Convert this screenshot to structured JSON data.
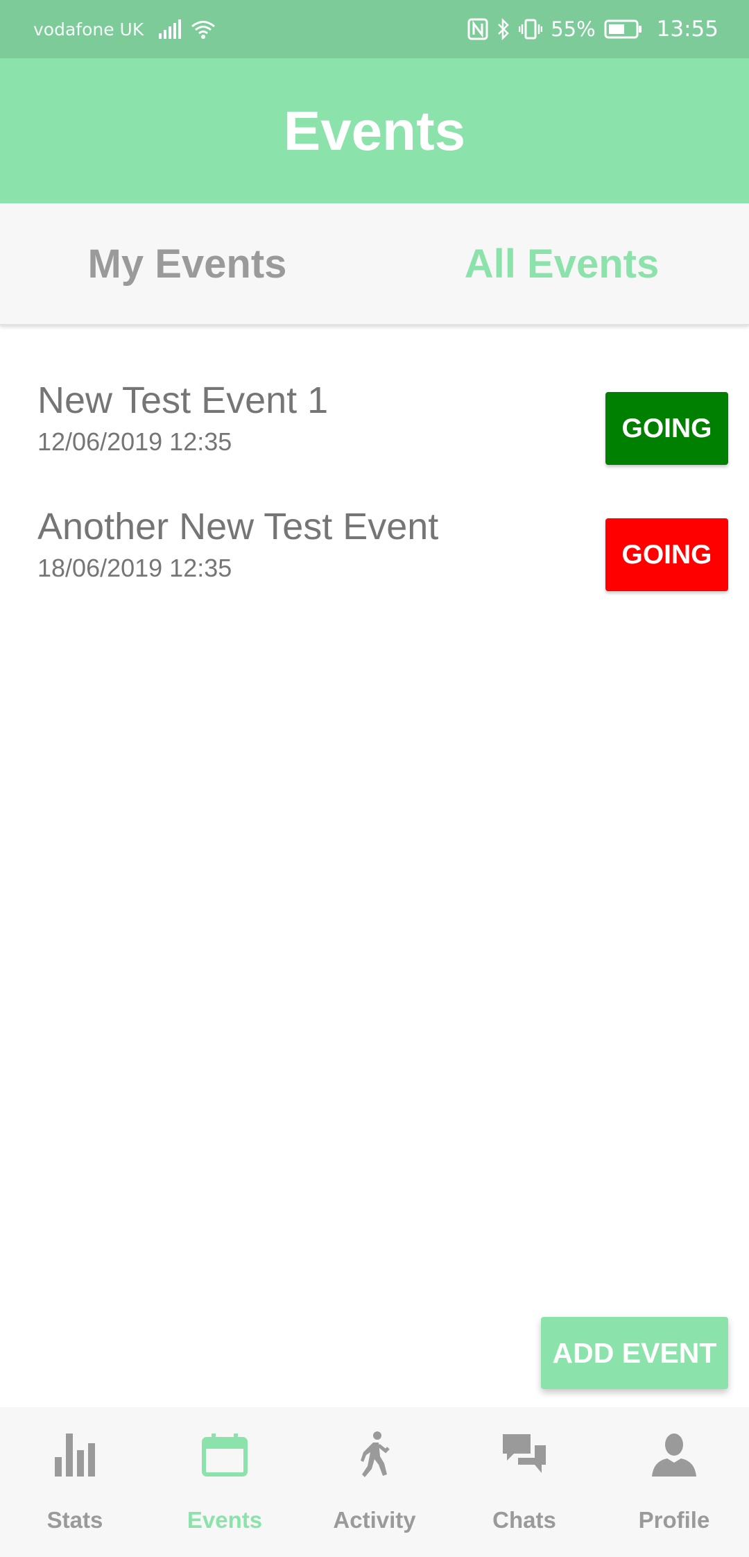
{
  "status_bar": {
    "carrier": "vodafone UK",
    "battery_percent": "55%",
    "time": "13:55"
  },
  "header": {
    "title": "Events"
  },
  "tabs": [
    {
      "label": "My Events",
      "active": false
    },
    {
      "label": "All Events",
      "active": true
    }
  ],
  "events": [
    {
      "name": "New Test Event 1",
      "datetime": "12/06/2019 12:35",
      "button_label": "GOING",
      "button_color": "#008000"
    },
    {
      "name": "Another New Test Event",
      "datetime": "18/06/2019 12:35",
      "button_label": "GOING",
      "button_color": "#ff0000"
    }
  ],
  "add_event": {
    "label": "ADD EVENT"
  },
  "bottom_nav": {
    "items": [
      {
        "label": "Stats",
        "icon": "bar-chart-icon",
        "active": false
      },
      {
        "label": "Events",
        "icon": "calendar-icon",
        "active": true
      },
      {
        "label": "Activity",
        "icon": "walking-person-icon",
        "active": false
      },
      {
        "label": "Chats",
        "icon": "chat-bubbles-icon",
        "active": false
      },
      {
        "label": "Profile",
        "icon": "person-icon",
        "active": false
      }
    ]
  },
  "colors": {
    "status_bar": "#7ecb9a",
    "accent": "#8be3ab",
    "inactive": "#9a9a9a",
    "going_yes": "#008000",
    "going_no": "#ff0000"
  }
}
